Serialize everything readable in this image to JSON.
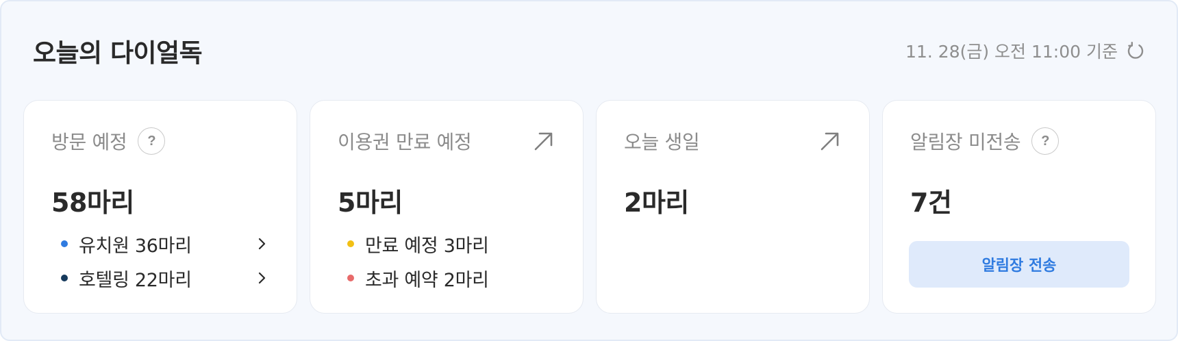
{
  "header": {
    "title": "오늘의 다이얼독",
    "timestamp": "11. 28(금) 오전 11:00 기준",
    "refresh_icon": "refresh-icon"
  },
  "colors": {
    "kindergarten_dot": "#2f7be0",
    "hoteling_dot": "#163a5c",
    "expiring_dot": "#f2c014",
    "overbooked_dot": "#e86a6a",
    "send_button_bg": "#dfeafb",
    "send_button_text": "#2f7be0"
  },
  "cards": {
    "visits": {
      "title": "방문 예정",
      "help_icon": "?",
      "value": "58마리",
      "rows": [
        {
          "label": "유치원 36마리"
        },
        {
          "label": "호텔링 22마리"
        }
      ]
    },
    "pass_expiring": {
      "title": "이용권 만료 예정",
      "value": "5마리",
      "rows": [
        {
          "label": "만료 예정 3마리"
        },
        {
          "label": "초과 예약 2마리"
        }
      ]
    },
    "birthday": {
      "title": "오늘 생일",
      "value": "2마리"
    },
    "alimtalk": {
      "title": "알림장 미전송",
      "help_icon": "?",
      "value": "7건",
      "button_label": "알림장 전송"
    }
  }
}
